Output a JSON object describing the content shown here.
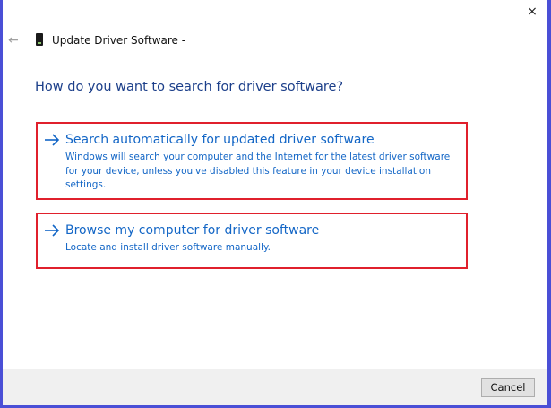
{
  "window": {
    "title": "Update Driver Software -",
    "close_glyph": "×"
  },
  "header": {
    "back_glyph": "←"
  },
  "main": {
    "heading": "How do you want to search for driver software?",
    "options": [
      {
        "title": "Search automatically for updated driver software",
        "description": "Windows will search your computer and the Internet for the latest driver software for your device, unless you've disabled this feature in your device installation settings."
      },
      {
        "title": "Browse my computer for driver software",
        "description": "Locate and install driver software manually."
      }
    ]
  },
  "footer": {
    "cancel_label": "Cancel"
  },
  "colors": {
    "link": "#1366c6",
    "heading": "#1c3f8a",
    "highlight_border": "#e0202c",
    "background": "#4a4fd6"
  }
}
